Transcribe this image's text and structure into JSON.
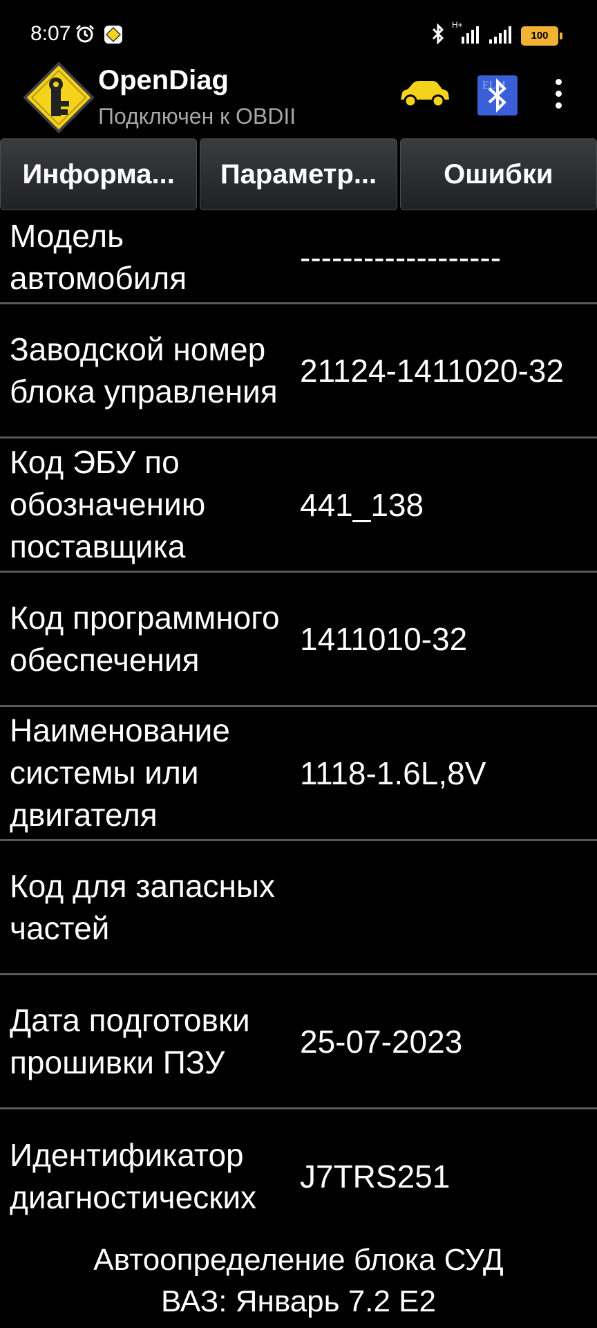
{
  "status_bar": {
    "time": "8:07",
    "network_label": "H+",
    "battery": "100"
  },
  "app_bar": {
    "title": "OpenDiag",
    "subtitle": "Подключен к OBDII"
  },
  "tabs": [
    {
      "label": "Информа..."
    },
    {
      "label": "Параметр..."
    },
    {
      "label": "Ошибки"
    }
  ],
  "info_rows": [
    {
      "label": "Модель автомобиля",
      "value": "-------------------"
    },
    {
      "label": "Заводской номер блока управления",
      "value": "21124-1411020-32"
    },
    {
      "label": "Код ЭБУ по обозначению поставщика",
      "value": "441_138"
    },
    {
      "label": "Код программного обеспечения",
      "value": "1411010-32"
    },
    {
      "label": "Наименование системы или двигателя",
      "value": "1118-1.6L,8V"
    },
    {
      "label": "Код для запасных частей",
      "value": ""
    },
    {
      "label": "Дата подготовки прошивки ПЗУ",
      "value": "25-07-2023"
    },
    {
      "label": "Идентификатор диагностических",
      "value": "J7TRS251"
    }
  ],
  "footer": {
    "line1": "Автоопределение блока СУД",
    "line2": "ВАЗ: Январь 7.2 Е2"
  },
  "colors": {
    "background": "#000000",
    "battery": "#f2b233",
    "logo_yellow": "#f5d21c",
    "bluetooth_bg": "#3b5fd6"
  },
  "icons": [
    "alarm-icon",
    "notification-app-icon",
    "bluetooth-status-icon",
    "signal-icon",
    "battery-icon",
    "opendiag-logo-icon",
    "car-icon",
    "bluetooth-adapter-icon",
    "overflow-menu-icon"
  ]
}
